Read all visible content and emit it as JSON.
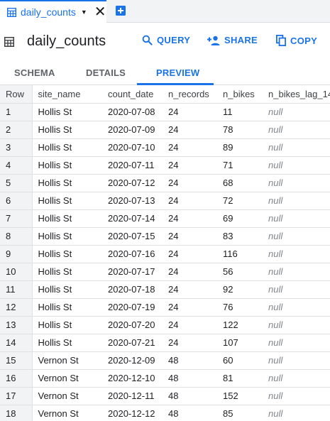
{
  "tab": {
    "label": "daily_counts"
  },
  "header": {
    "title": "daily_counts",
    "query_label": "QUERY",
    "share_label": "SHARE",
    "copy_label": "COPY"
  },
  "subtabs": {
    "schema": "SCHEMA",
    "details": "DETAILS",
    "preview": "PREVIEW"
  },
  "accent_color": "#1a73e8",
  "table": {
    "columns": [
      "Row",
      "site_name",
      "count_date",
      "n_records",
      "n_bikes",
      "n_bikes_lag_14"
    ],
    "rows": [
      [
        "1",
        "Hollis St",
        "2020-07-08",
        "24",
        "11",
        "null"
      ],
      [
        "2",
        "Hollis St",
        "2020-07-09",
        "24",
        "78",
        "null"
      ],
      [
        "3",
        "Hollis St",
        "2020-07-10",
        "24",
        "89",
        "null"
      ],
      [
        "4",
        "Hollis St",
        "2020-07-11",
        "24",
        "71",
        "null"
      ],
      [
        "5",
        "Hollis St",
        "2020-07-12",
        "24",
        "68",
        "null"
      ],
      [
        "6",
        "Hollis St",
        "2020-07-13",
        "24",
        "72",
        "null"
      ],
      [
        "7",
        "Hollis St",
        "2020-07-14",
        "24",
        "69",
        "null"
      ],
      [
        "8",
        "Hollis St",
        "2020-07-15",
        "24",
        "83",
        "null"
      ],
      [
        "9",
        "Hollis St",
        "2020-07-16",
        "24",
        "116",
        "null"
      ],
      [
        "10",
        "Hollis St",
        "2020-07-17",
        "24",
        "56",
        "null"
      ],
      [
        "11",
        "Hollis St",
        "2020-07-18",
        "24",
        "92",
        "null"
      ],
      [
        "12",
        "Hollis St",
        "2020-07-19",
        "24",
        "76",
        "null"
      ],
      [
        "13",
        "Hollis St",
        "2020-07-20",
        "24",
        "122",
        "null"
      ],
      [
        "14",
        "Hollis St",
        "2020-07-21",
        "24",
        "107",
        "null"
      ],
      [
        "15",
        "Vernon St",
        "2020-12-09",
        "48",
        "60",
        "null"
      ],
      [
        "16",
        "Vernon St",
        "2020-12-10",
        "48",
        "81",
        "null"
      ],
      [
        "17",
        "Vernon St",
        "2020-12-11",
        "48",
        "152",
        "null"
      ],
      [
        "18",
        "Vernon St",
        "2020-12-12",
        "48",
        "85",
        "null"
      ]
    ]
  }
}
